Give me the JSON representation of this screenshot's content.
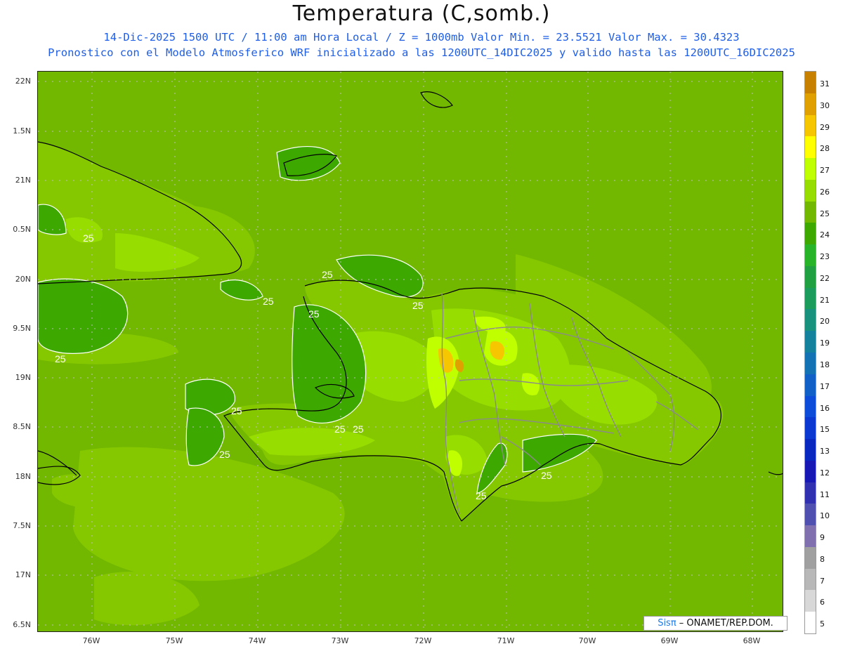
{
  "title": "Temperatura (C,somb.)",
  "subtitle_line1": "14-Dic-2025 1500 UTC / 11:00 am Hora Local / Z = 1000mb  Valor Min. = 23.5521  Valor Max. = 30.4323",
  "subtitle_line2": "Pronostico con el Modelo Atmosferico WRF inicializado a las 1200UTC_14DIC2025 y valido hasta las  1200UTC_16DIC2025",
  "lat_labels": [
    "22N",
    "1.5N",
    "21N",
    "0.5N",
    "20N",
    "9.5N",
    "19N",
    "8.5N",
    "18N",
    "7.5N",
    "17N",
    "6.5N"
  ],
  "lon_labels": [
    "76W",
    "75W",
    "74W",
    "73W",
    "72W",
    "71W",
    "70W",
    "69W",
    "68W"
  ],
  "legend_labels": [
    "31",
    "30",
    "29",
    "28",
    "27",
    "26",
    "25",
    "24",
    "23",
    "22",
    "21",
    "20",
    "19",
    "18",
    "17",
    "16",
    "15",
    "13",
    "12",
    "11",
    "10",
    "9",
    "8",
    "7",
    "6",
    "5"
  ],
  "legend_colors": [
    "#c88000",
    "#e0a000",
    "#f6c600",
    "#ffff00",
    "#c0ff00",
    "#98dd00",
    "#72b800",
    "#3ca800",
    "#28b428",
    "#20a040",
    "#1c9c5c",
    "#18927c",
    "#14829c",
    "#1272b4",
    "#1060c8",
    "#0c4cd8",
    "#0a38d0",
    "#0828c0",
    "#1818b4",
    "#3030b0",
    "#5050b0",
    "#8070b0",
    "#a0a0a0",
    "#b8b8b8",
    "#d8d8d8",
    "#ffffff"
  ],
  "contour_label": "25",
  "credit_sis": "Sisπ",
  "credit_text": " – ONAMET/REP.DOM."
}
